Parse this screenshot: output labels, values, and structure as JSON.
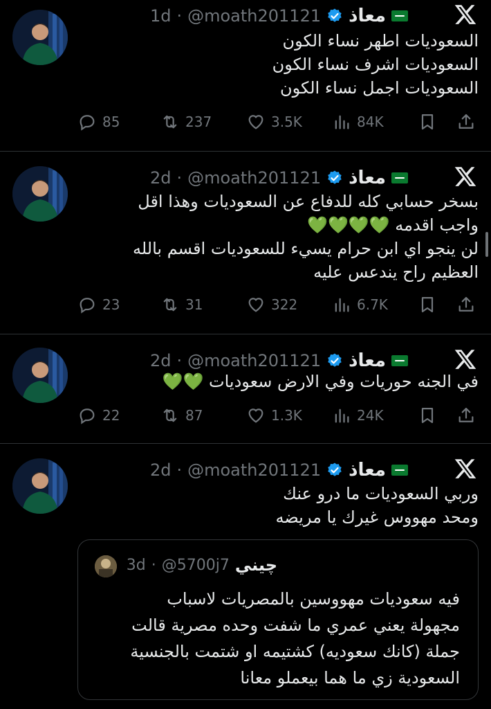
{
  "tweets": [
    {
      "name": "معاذ",
      "handle": "@moath201121",
      "time": "1d",
      "lines": [
        "السعوديات اطهر نساء الكون",
        "السعوديات اشرف نساء الكون",
        "السعوديات اجمل نساء الكون"
      ],
      "replies": "85",
      "retweets": "237",
      "likes": "3.5K",
      "views": "84K"
    },
    {
      "name": "معاذ",
      "handle": "@moath201121",
      "time": "2d",
      "lines": [
        "بسخر حسابي كله للدفاع عن السعوديات وهذا اقل",
        "واجب اقدمه",
        "لن ينجو اي ابن حرام يسيء للسعوديات اقسم بالله",
        "العظيم راح يندعس عليه"
      ],
      "hearts": "💚💚💚💚",
      "replies": "23",
      "retweets": "31",
      "likes": "322",
      "views": "6.7K"
    },
    {
      "name": "معاذ",
      "handle": "@moath201121",
      "time": "2d",
      "lines": [
        "في الجنه حوريات وفي الارض سعوديات"
      ],
      "hearts": "💚💚",
      "replies": "22",
      "retweets": "87",
      "likes": "1.3K",
      "views": "24K"
    },
    {
      "name": "معاذ",
      "handle": "@moath201121",
      "time": "2d",
      "lines": [
        "وربي السعوديات ما درو عنك",
        "ومحد مهووس غيرك يا مريضه"
      ]
    }
  ],
  "quote": {
    "name": "چيني",
    "handle": "@5700j7",
    "time": "3d",
    "lines": [
      "فيه سعوديات مهووسين بالمصريات لاسباب",
      "مجهولة يعني عمري ما شفت وحده مصرية قالت",
      "جملة (كانك سعوديه) كشتيمه او شتمت بالجنسية",
      "السعودية زي ما هما بيعملو معانا"
    ]
  },
  "separator": "·",
  "colors": {
    "background": "#000000",
    "text": "#e7e9ea",
    "muted": "#71767b",
    "verified": "#1d9bf0",
    "heart_emoji": "#4ad32c",
    "flag": "#0a7a2f"
  },
  "icons": [
    "x-logo-icon",
    "verified-badge-icon",
    "saudi-flag-icon",
    "reply-icon",
    "retweet-icon",
    "like-icon",
    "views-icon",
    "bookmark-icon",
    "share-icon"
  ]
}
